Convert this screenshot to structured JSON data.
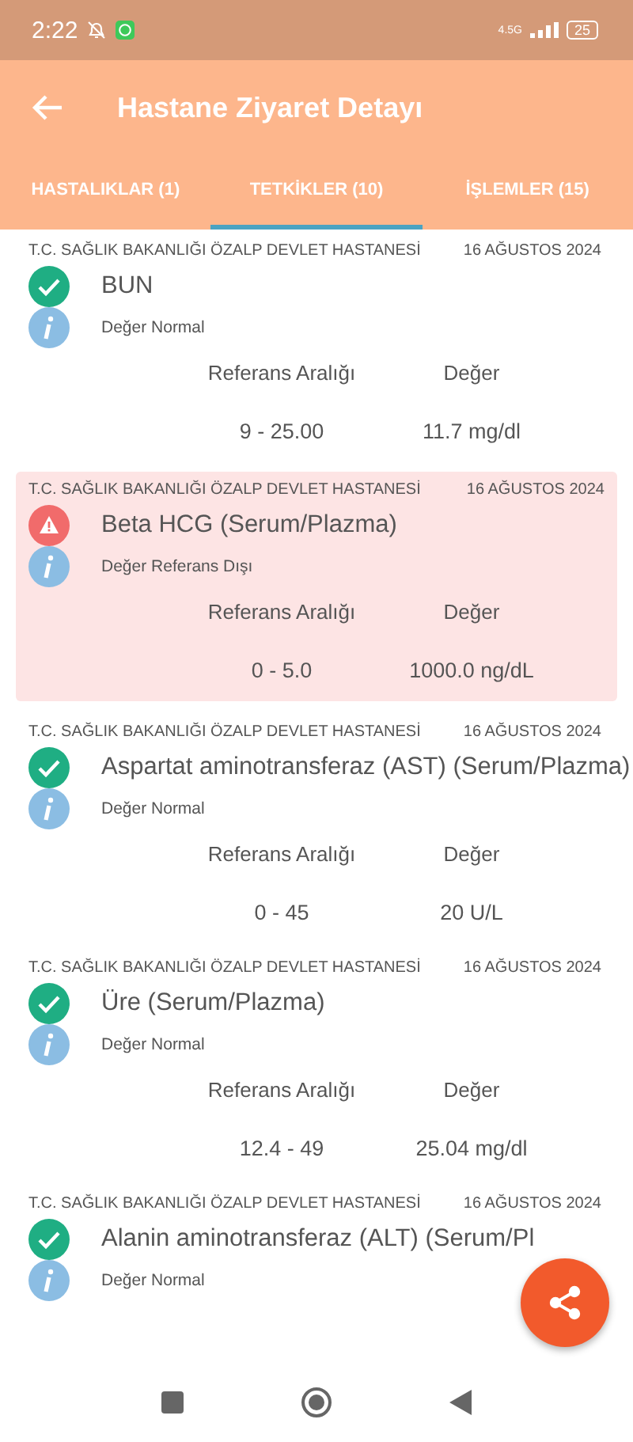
{
  "status_bar": {
    "time": "2:22",
    "battery": "25",
    "network": "4.5G"
  },
  "app_bar": {
    "title": "Hastane Ziyaret Detayı"
  },
  "tabs": [
    {
      "label": "HASTALIKLAR (1)",
      "selected": false
    },
    {
      "label": "TETKİKLER (10)",
      "selected": true
    },
    {
      "label": "İŞLEMLER (15)",
      "selected": false
    }
  ],
  "results": [
    {
      "hospital": "T.C. SAĞLIK BAKANLIĞI ÖZALP DEVLET HASTANESİ",
      "date": "16 AĞUSTOS 2024",
      "test": "BUN",
      "kind": "normal",
      "note": "Değer Normal",
      "range_label": "Referans Aralığı",
      "value_label": "Değer",
      "range": "9 - 25.00",
      "value": "11.7 mg/dl"
    },
    {
      "hospital": "T.C. SAĞLIK BAKANLIĞI ÖZALP DEVLET HASTANESİ",
      "date": "16 AĞUSTOS 2024",
      "test": "Beta HCG (Serum/Plazma)",
      "kind": "alert",
      "note": "Değer Referans Dışı",
      "range_label": "Referans Aralığı",
      "value_label": "Değer",
      "range": "0 - 5.0",
      "value": "1000.0 ng/dL"
    },
    {
      "hospital": "T.C. SAĞLIK BAKANLIĞI ÖZALP DEVLET HASTANESİ",
      "date": "16 AĞUSTOS 2024",
      "test": "Aspartat aminotransferaz (AST) (Serum/Plazma)",
      "kind": "normal",
      "note": "Değer Normal",
      "range_label": "Referans Aralığı",
      "value_label": "Değer",
      "range": "0 - 45",
      "value": "20 U/L"
    },
    {
      "hospital": "T.C. SAĞLIK BAKANLIĞI ÖZALP DEVLET HASTANESİ",
      "date": "16 AĞUSTOS 2024",
      "test": "Üre (Serum/Plazma)",
      "kind": "normal",
      "note": "Değer Normal",
      "range_label": "Referans Aralığı",
      "value_label": "Değer",
      "range": "12.4 - 49",
      "value": "25.04 mg/dl"
    },
    {
      "hospital": "T.C. SAĞLIK BAKANLIĞI ÖZALP DEVLET HASTANESİ",
      "date": "16 AĞUSTOS 2024",
      "test": "Alanin aminotransferaz (ALT) (Serum/Pl",
      "kind": "normal",
      "note": "Değer Normal"
    }
  ]
}
